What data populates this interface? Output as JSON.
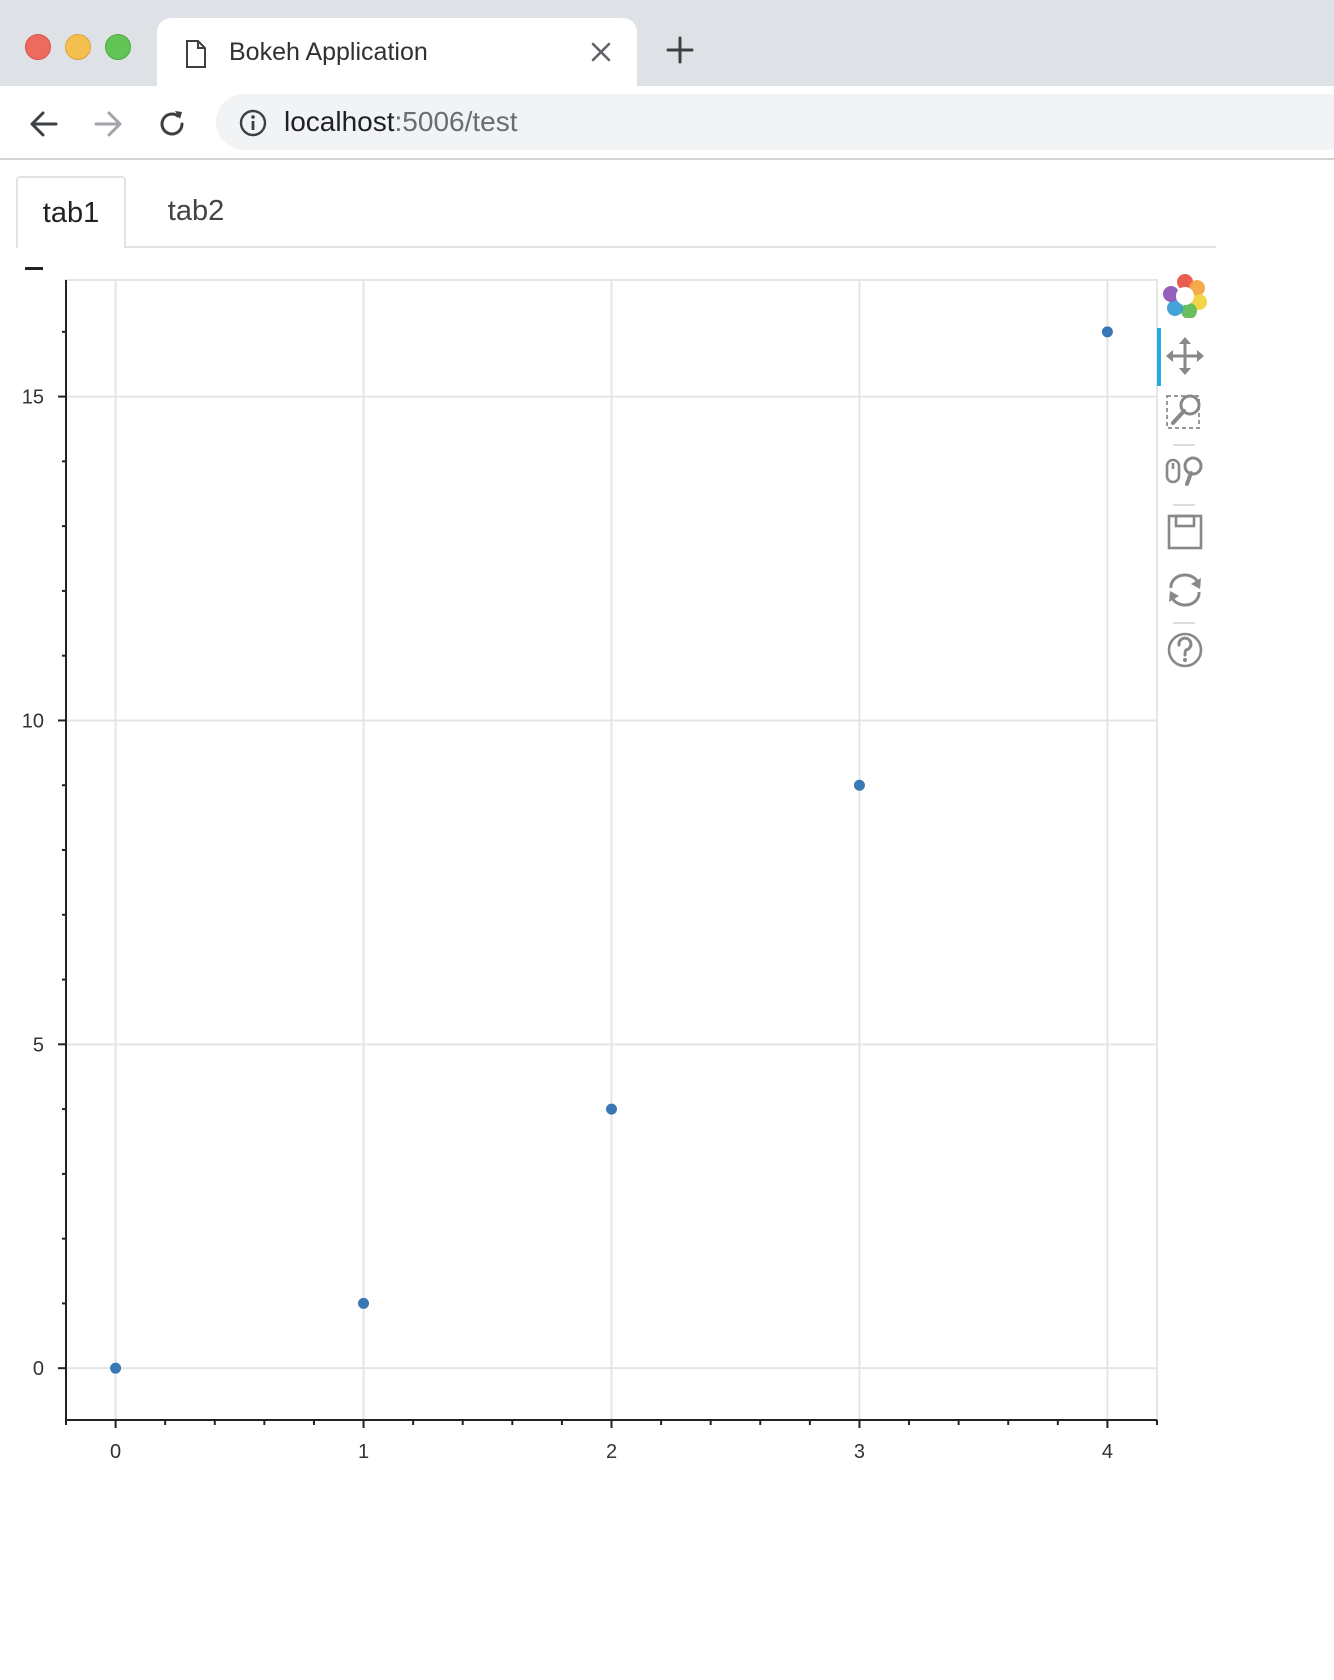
{
  "browser": {
    "tab_title": "Bokeh Application",
    "url_host": "localhost",
    "url_path": ":5006/test"
  },
  "bokeh_tabs": [
    {
      "label": "tab1",
      "active": true
    },
    {
      "label": "tab2",
      "active": false
    }
  ],
  "toolbar_tools": [
    "bokeh-logo",
    "pan-tool",
    "box-zoom-tool",
    "wheel-zoom-tool",
    "save-tool",
    "reset-tool",
    "help-tool"
  ],
  "colors": {
    "marker": "#3a78b5",
    "grid": "#e5e5e5",
    "active_tool": "#26aae1"
  },
  "chart_data": {
    "type": "scatter",
    "title": "",
    "xlabel": "",
    "ylabel": "",
    "x": [
      0,
      1,
      2,
      3,
      4
    ],
    "y": [
      0,
      1,
      4,
      9,
      16
    ],
    "xlim": [
      -0.2,
      4.2
    ],
    "ylim": [
      -0.8,
      16.8
    ],
    "x_ticks": [
      "0",
      "1",
      "2",
      "3",
      "4"
    ],
    "y_ticks": [
      "0",
      "5",
      "10",
      "15"
    ],
    "grid": true
  }
}
